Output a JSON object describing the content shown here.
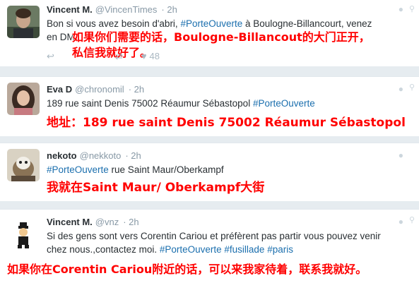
{
  "tweets": [
    {
      "name": "Vincent M.",
      "handle": "@VincenTimes",
      "time": "· 2h",
      "text_before": "Bon si vous avez besoin d'abri, ",
      "hashtag": "#PorteOuverte",
      "text_after": " à Boulogne-Billancourt, venez",
      "text_line2": "en DM",
      "caption_line1": "如果你们需要的话，Boulogne-Billancout的大门正开，",
      "caption_line2": "私信我就好了。",
      "like_count": "48"
    },
    {
      "name": "Eva D",
      "handle": "@chronomil",
      "time": "· 2h",
      "text_before": "189 rue saint Denis 75002 Réaumur Sébastopol ",
      "hashtag": "#PorteOuverte",
      "caption": "地址：189 rue saint Denis 75002 Réaumur Sébastopol"
    },
    {
      "name": "nekoto",
      "handle": "@nekkoto",
      "time": "· 2h",
      "hashtag": "#PorteOuverte",
      "text_after": " rue Saint Maur/Oberkampf",
      "caption": "我就在Saint Maur/ Oberkampf大街"
    },
    {
      "name": "Vincent M.",
      "handle": "@vnz",
      "time": "· 2h",
      "text_line1": "Si des gens sont vers Corentin Cariou et préfèrent pas partir vous pouvez venir",
      "text_line2_before": "chez nous.,contactez moi. ",
      "hashtag1": "#PorteOuverte",
      "hashtag2": "#fusillade",
      "hashtag3": "#paris",
      "caption": "如果你在Corentin Cariou附近的话，可以来我家待着，联系我就好。"
    }
  ],
  "colors": {
    "hashtag": "#1b6fae",
    "caption": "#ff0000",
    "background": "#e6ecf0"
  }
}
